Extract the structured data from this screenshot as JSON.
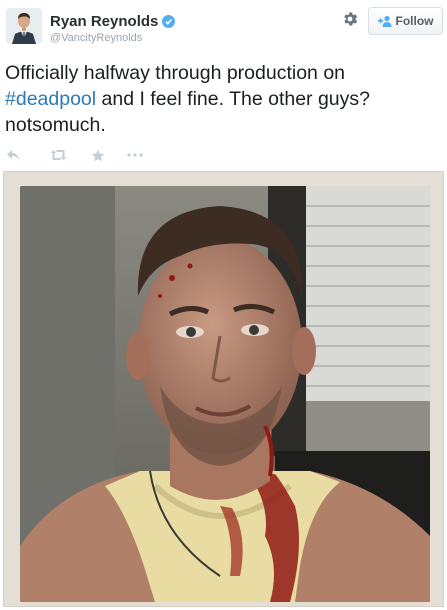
{
  "user": {
    "name": "Ryan Reynolds",
    "handle": "@VancityReynolds",
    "verified": true
  },
  "header": {
    "settings_icon": "gear-icon",
    "follow_label": "Follow"
  },
  "tweet": {
    "text_before": "Officially halfway through production on",
    "hashtag": "#deadpool",
    "text_after": " and I feel fine. The other guys? notsomuch."
  },
  "actions": {
    "icons": [
      "reply-icon",
      "retweet-icon",
      "favorite-icon",
      "more-icon"
    ]
  },
  "colors": {
    "link": "#2b7bb9",
    "verified": "#55acee",
    "action_icon": "#c5ced4"
  }
}
